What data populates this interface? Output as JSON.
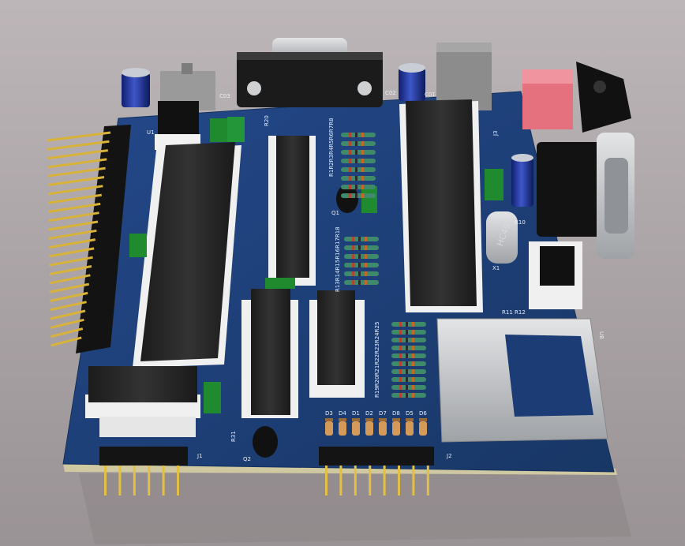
{
  "scene": {
    "title": "",
    "colors": {
      "background": "#b3acae",
      "pcb": "#1c3f7a",
      "pcb_edge": "#c9c39a",
      "ic_body": "#2a2a2a",
      "socket": "#efefef",
      "gold": "#d9b23a",
      "header": "#151515",
      "cap_blue": "#1b2f9a",
      "green_cap": "#1f8a2e",
      "sd_metal": "#c8c9cc",
      "db9_metal": "#b9bcc0",
      "pink_switch": "#e86c7c"
    }
  },
  "labels": {
    "crystal": "HC49",
    "x1": "X1",
    "j1": "J1",
    "j2": "J2",
    "j3": "J3",
    "c03": "C03",
    "c02": "C02",
    "c01": "C01",
    "u1": "U1",
    "r20": "R20",
    "q1": "Q1",
    "q2": "Q2",
    "r31": "R31",
    "r11": "R11",
    "r12": "R12",
    "r10": "R10",
    "c04": "C04",
    "d3": "D3",
    "d4": "D4",
    "d1": "D1",
    "d2": "D2",
    "d7": "D7",
    "d8": "D8",
    "d5": "D5",
    "d6": "D6",
    "r_col1": "R1R2R3R4R5R6R7R8",
    "r_col2": "R13R14R15R16R17R18",
    "r_col3": "R19R20R21R22R23R24R25",
    "u8": "U8"
  }
}
